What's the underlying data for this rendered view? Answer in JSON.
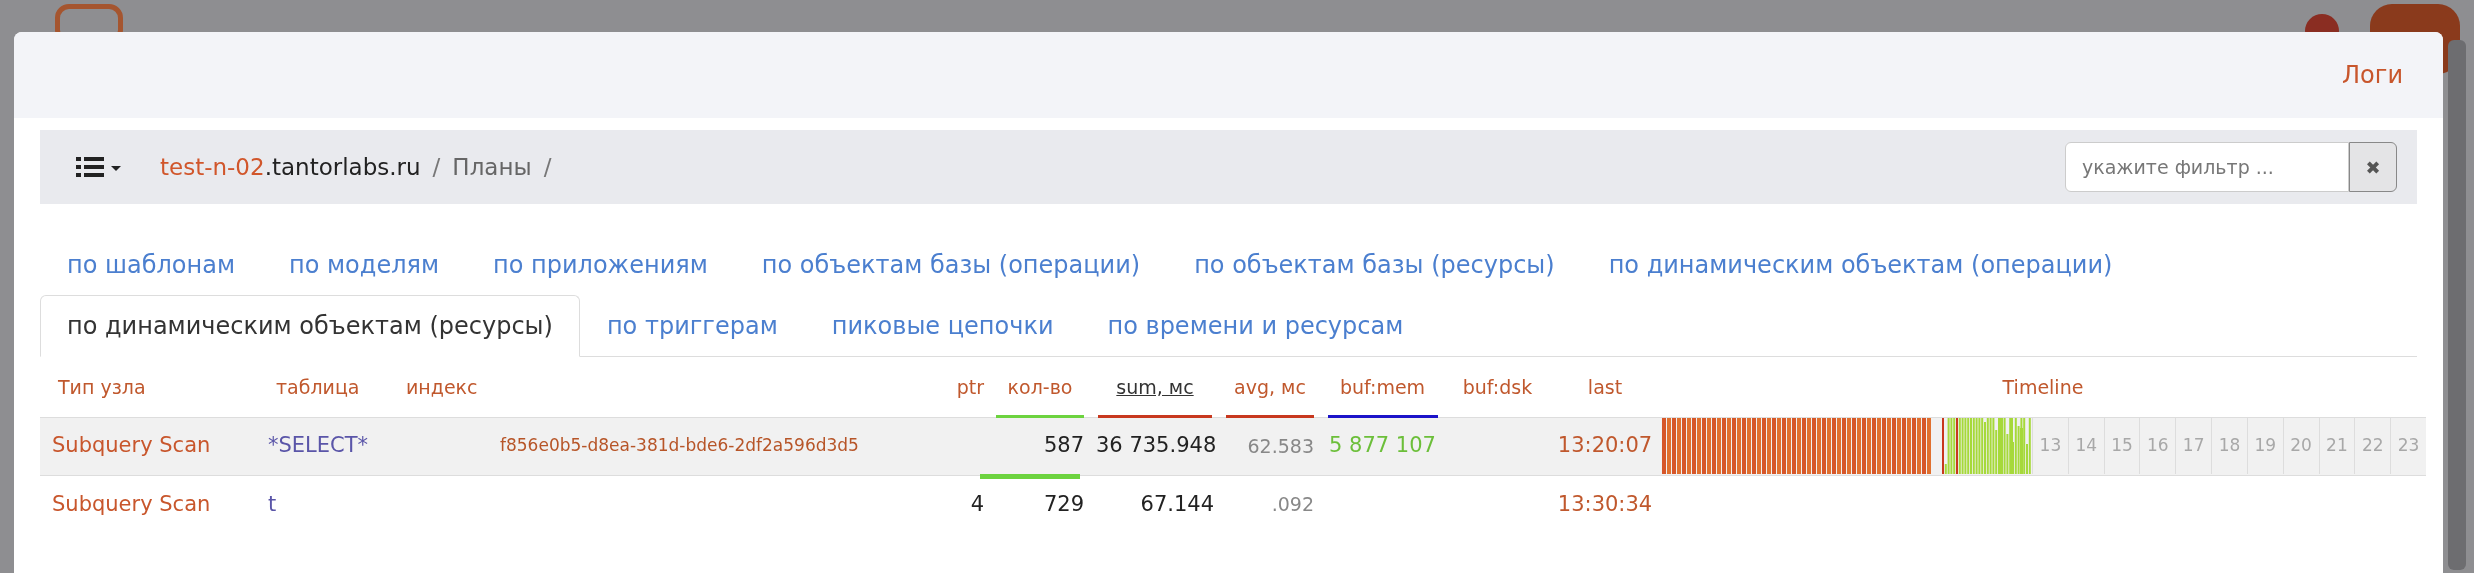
{
  "modal": {
    "header_link": "Логи"
  },
  "breadcrumb": {
    "host_prefix": "test-n-02",
    "host_suffix": ".tantorlabs.ru",
    "separator_1": "/",
    "section": "Планы",
    "separator_2": "/"
  },
  "filter": {
    "placeholder": "укажите фильтр ...",
    "clear": "✖"
  },
  "tabs": [
    {
      "label": "по шаблонам",
      "selected": false
    },
    {
      "label": "по моделям",
      "selected": false
    },
    {
      "label": "по приложениям",
      "selected": false
    },
    {
      "label": "по объектам базы (операции)",
      "selected": false
    },
    {
      "label": "по объектам базы (ресурсы)",
      "selected": false
    },
    {
      "label": "по динамическим объектам (операции)",
      "selected": false
    },
    {
      "label": "по динамическим объектам (ресурсы)",
      "selected": true
    },
    {
      "label": "по триггерам",
      "selected": false
    },
    {
      "label": "пиковые цепочки",
      "selected": false
    },
    {
      "label": "по времени и ресурсам",
      "selected": false
    }
  ],
  "table": {
    "columns": [
      {
        "label": "Тип узла",
        "sorted": false
      },
      {
        "label": "таблица",
        "sorted": false
      },
      {
        "label": "индекс",
        "sorted": false
      },
      {
        "label": "ptr",
        "sorted": false
      },
      {
        "label": "кол-во",
        "sorted": false,
        "color": "#6cd33f"
      },
      {
        "label": "sum, мс",
        "sorted": true,
        "color": "#c8381e"
      },
      {
        "label": "avg, мс",
        "sorted": false,
        "color": "#c8381e"
      },
      {
        "label": "buf:mem",
        "sorted": false,
        "color": "#1b13c9"
      },
      {
        "label": "buf:dsk",
        "sorted": false
      },
      {
        "label": "last",
        "sorted": false
      },
      {
        "label": "Timeline",
        "sorted": false
      }
    ],
    "rows": [
      {
        "selected": true,
        "count_marked": false,
        "cells": [
          "Subquery Scan",
          "*SELECT*",
          "f856e0b5-d8ea-381d-bde6-2df2a596d3d5",
          "",
          "587",
          "36 735.948",
          "62.583",
          "5 877 107",
          "",
          "13:20:07"
        ],
        "timeline": {
          "hours": [
            "13",
            "14",
            "15",
            "16",
            "17",
            "18",
            "19",
            "20",
            "21",
            "22",
            "23"
          ]
        }
      },
      {
        "selected": false,
        "count_marked": true,
        "cells": [
          "Subquery Scan",
          "t",
          "",
          "4",
          "729",
          "67.144",
          ".092",
          "",
          "",
          "13:30:34"
        ]
      }
    ]
  }
}
